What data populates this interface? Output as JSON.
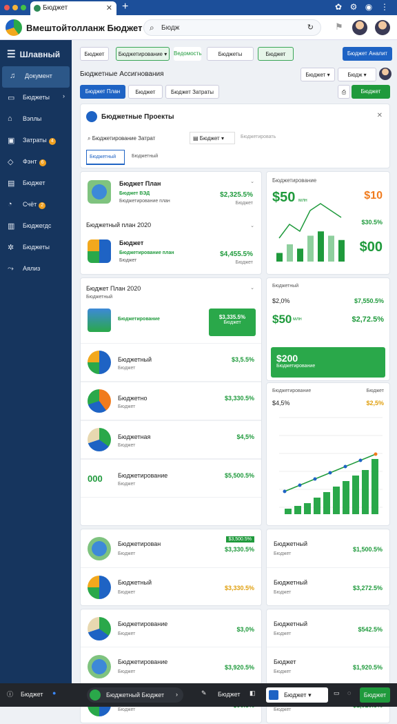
{
  "browser": {
    "tab_title": "Бюджет",
    "new_tab": "+"
  },
  "header": {
    "app_name": "Вмештойтолланж Бюджет",
    "search_placeholder": "Бюдж"
  },
  "sidebar": {
    "title": "Шлавный",
    "items": [
      {
        "label": "Документ",
        "icon": "bell-icon"
      },
      {
        "label": "Бюджеты",
        "icon": "doc-icon"
      },
      {
        "label": "Вэплы",
        "icon": "home-icon"
      },
      {
        "label": "Затраты",
        "icon": "box-icon",
        "badge": "4"
      },
      {
        "label": "Фэнт",
        "icon": "tag-icon",
        "badge": "6"
      },
      {
        "label": "Бюджет",
        "icon": "chart-icon"
      },
      {
        "label": "Счёт",
        "icon": "wallet-icon",
        "badge": "2"
      },
      {
        "label": "Бюджегдс",
        "icon": "build-icon"
      },
      {
        "label": "Бюджеты",
        "icon": "gear-icon"
      },
      {
        "label": "Аялиз",
        "icon": "trend-icon"
      }
    ]
  },
  "toolbar": {
    "btn1": "Бюджет",
    "btn2": "Бюджетирование",
    "btn3": "Ведомость",
    "btn4": "Бюджеты",
    "btn5": "Бюджет",
    "btn6": "Бюджет Аналит"
  },
  "subheader": {
    "title": "Бюджетные Ассигнования",
    "select1": "Бюджет",
    "select2": "Бюдж",
    "tab1": "Бюджет План",
    "tab2": "Бюджет",
    "tab3": "Бюджет Затраты",
    "action": "Бюджет"
  },
  "panel": {
    "title": "Бюджетные Проекты",
    "search": "Бюджетирование Затрат",
    "filter": "Бюджет",
    "hint": "Бюджетировать",
    "tab_active": "Бюджетный",
    "tab2": "Бюджетный"
  },
  "list1": [
    {
      "title": "Бюджет План",
      "sub": "Бюджет ВЭД",
      "sub2": "Бюджетирование план",
      "value": "$2,325.5%",
      "sub3": "Бюджет"
    },
    {
      "title": "Бюджет",
      "sub": "Бюджетирование план",
      "sub2": "Бюджет",
      "value": "$4,455.5%",
      "sub3": "Бюджет"
    }
  ],
  "list1_header": "Бюджетный план 2020",
  "chart1": {
    "title": "Бюджетирование",
    "big": "$50",
    "unit": "млн",
    "right": "$10",
    "right_pct": "$30.5%",
    "bottom": "$00",
    "data": [
      2,
      4,
      3,
      6,
      7,
      6,
      5
    ]
  },
  "section2": {
    "title": "Бюджет План 2020",
    "sub": "Бюджетный",
    "feature": "Бюджетирование",
    "feature_value": "$3,335.5%",
    "feature_sub": "Бюджет",
    "rows": [
      {
        "title": "Бюджетный",
        "value": "$3,5.5%",
        "sub": "Бюджет"
      },
      {
        "title": "Бюджетно",
        "value": "$3,330.5%",
        "sub": "Бюджет"
      },
      {
        "title": "Бюджетная",
        "value": "$4,5%",
        "sub": "Бюджет"
      },
      {
        "title": "Бюджетирование",
        "value": "$5,500.5%",
        "sub": "Бюджет",
        "big": "000"
      }
    ]
  },
  "side2": {
    "title": "Бюджетный",
    "pct": "$2,0%",
    "value": "$7,550.5%",
    "big": "$50",
    "unit": "млн",
    "v2": "$2,72.5%",
    "green_big": "$200",
    "green_sub": "Бюджетирование"
  },
  "chart2": {
    "title": "Бюджетирование",
    "left": "$4,5%",
    "right": "$2,5%",
    "rlabel": "Бюджет",
    "bars": [
      1,
      1.5,
      2,
      3,
      4,
      5,
      6,
      7,
      8,
      10
    ],
    "line": [
      2,
      3,
      4,
      5,
      6,
      7,
      8
    ]
  },
  "list3": [
    {
      "title": "Бюджетирован",
      "value": "$3,330.5%",
      "sub": "Бюджет",
      "badge": "$3,500.5%"
    },
    {
      "title": "Бюджетный",
      "value": "$3,330.5%",
      "sub": "Бюджет"
    }
  ],
  "side3": [
    {
      "title": "Бюджетный",
      "value": "$1,500.5%",
      "sub": "Бюджет"
    },
    {
      "title": "Бюджетный",
      "value": "$3,272.5%",
      "sub": "Бюджет"
    }
  ],
  "list4": [
    {
      "title": "Бюджетирование",
      "value": "$3,0%",
      "sub": "Бюджет"
    },
    {
      "title": "Бюджетирование",
      "value": "$3,920.5%",
      "sub": "Бюджет"
    },
    {
      "title": "Бюджетный",
      "value": "$90.5%",
      "sub": "Бюджет"
    }
  ],
  "side4": [
    {
      "title": "Бюджетный",
      "value": "$542.5%",
      "sub": "Бюджет"
    },
    {
      "title": "Бюджет",
      "value": "$1,920.5%",
      "sub": "Бюджет"
    },
    {
      "title": "Бюджет",
      "value": "$1,920.5%",
      "sub": "Бюджет"
    }
  ],
  "footer": {
    "left": "Бюджет",
    "pill": "Бюджетный Бюджет",
    "nav": "Бюджет",
    "select": "Бюджет",
    "go": "Бюджет"
  },
  "colors": {
    "green": "#1f9a3c",
    "navy": "#16355e",
    "blue": "#1e63c4"
  }
}
